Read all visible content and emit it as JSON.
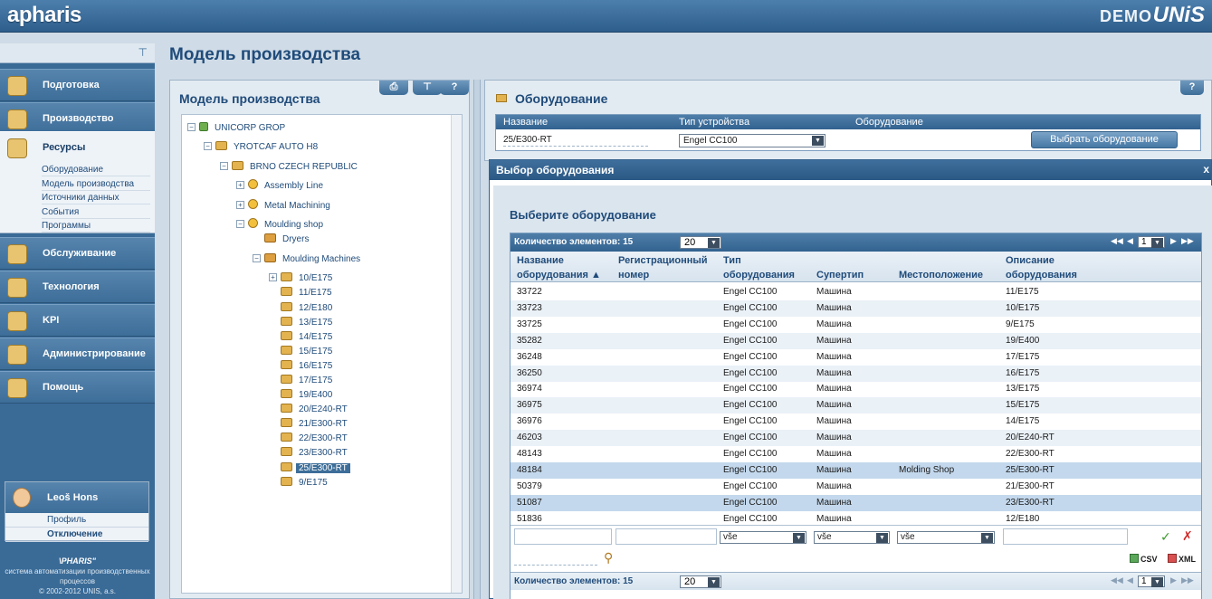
{
  "brand": {
    "logo": "apharis",
    "demo": "DEMO",
    "unis": "UNiS"
  },
  "page_title": "Модель производства",
  "menu": {
    "items": [
      {
        "label": "Подготовка",
        "icon": "book-icon"
      },
      {
        "label": "Производство",
        "icon": "wrench-icon"
      },
      {
        "label": "Ресурсы",
        "icon": "truck-icon"
      },
      {
        "label": "Обслуживание",
        "icon": "tools-icon"
      },
      {
        "label": "Технология",
        "icon": "gauge-icon"
      },
      {
        "label": "KPI",
        "icon": "chart-icon"
      },
      {
        "label": "Администрирование",
        "icon": "users-icon"
      },
      {
        "label": "Помощь",
        "icon": "help-icon"
      }
    ],
    "subitems": [
      "Оборудование",
      "Модель производства",
      "Источники данных",
      "События",
      "Программы"
    ]
  },
  "user": {
    "name": "Leoš Hons",
    "profile": "Профиль",
    "logout": "Отключение"
  },
  "footer": {
    "logo": "\\PHARIS\"",
    "line1": "система автоматизации производственных",
    "line2": "процессов",
    "copyright": "© 2002-2012 UNIS, a.s."
  },
  "tree_panel": {
    "title": "Модель производства",
    "buttons": {
      "print": "⎙",
      "pin": "⊤",
      "help": "?"
    },
    "nodes": [
      {
        "label": "UNICORP GROP",
        "level": 0,
        "exp": "−",
        "icon": "g"
      },
      {
        "label": "YROTCAF AUTO H8",
        "level": 1,
        "exp": "−",
        "icon": "f"
      },
      {
        "label": "BRNO CZECH REPUBLIC",
        "level": 2,
        "exp": "−",
        "icon": "f"
      },
      {
        "label": "Assembly Line",
        "level": 3,
        "exp": "+",
        "icon": "c"
      },
      {
        "label": "Metal Machining",
        "level": 3,
        "exp": "+",
        "icon": "c"
      },
      {
        "label": "Moulding shop",
        "level": 3,
        "exp": "−",
        "icon": "c"
      },
      {
        "label": "Dryers",
        "level": 4,
        "exp": "",
        "icon": "p"
      },
      {
        "label": "Moulding Machines",
        "level": 4,
        "exp": "−",
        "icon": "p"
      },
      {
        "label": "10/E175",
        "level": 5,
        "exp": "+",
        "icon": "f"
      },
      {
        "label": "11/E175",
        "level": 5,
        "exp": "",
        "icon": "f"
      },
      {
        "label": "12/E180",
        "level": 5,
        "exp": "",
        "icon": "f"
      },
      {
        "label": "13/E175",
        "level": 5,
        "exp": "",
        "icon": "f"
      },
      {
        "label": "14/E175",
        "level": 5,
        "exp": "",
        "icon": "f"
      },
      {
        "label": "15/E175",
        "level": 5,
        "exp": "",
        "icon": "f"
      },
      {
        "label": "16/E175",
        "level": 5,
        "exp": "",
        "icon": "f"
      },
      {
        "label": "17/E175",
        "level": 5,
        "exp": "",
        "icon": "f"
      },
      {
        "label": "19/E400",
        "level": 5,
        "exp": "",
        "icon": "f"
      },
      {
        "label": "20/E240-RT",
        "level": 5,
        "exp": "",
        "icon": "f"
      },
      {
        "label": "21/E300-RT",
        "level": 5,
        "exp": "",
        "icon": "f"
      },
      {
        "label": "22/E300-RT",
        "level": 5,
        "exp": "",
        "icon": "f"
      },
      {
        "label": "23/E300-RT",
        "level": 5,
        "exp": "",
        "icon": "f"
      },
      {
        "label": "25/E300-RT",
        "level": 5,
        "exp": "",
        "icon": "f",
        "selected": true
      },
      {
        "label": "9/E175",
        "level": 5,
        "exp": "",
        "icon": "f"
      }
    ]
  },
  "equipment_panel": {
    "title": "Оборудование",
    "help": "?",
    "headers": [
      "Название",
      "Тип устройства",
      "Оборудование"
    ],
    "name_value": "25/E300-RT",
    "type_value": "Engel CC100",
    "select_button": "Выбрать оборудование"
  },
  "modal": {
    "title": "Выбор оборудования",
    "close": "x",
    "subtitle": "Выберите оборудование",
    "count_label": "Количество элементов: 15",
    "page_size": "20",
    "page": "1",
    "columns": [
      {
        "line1": "Название",
        "line2": "оборудования ▲"
      },
      {
        "line1": "Регистрационный",
        "line2": "номер"
      },
      {
        "line1": "Тип",
        "line2": "оборудования"
      },
      {
        "line1": "",
        "line2": "Супертип"
      },
      {
        "line1": "",
        "line2": "Местоположение"
      },
      {
        "line1": "Описание",
        "line2": "оборудования"
      }
    ],
    "rows": [
      [
        "33722",
        "",
        "Engel CC100",
        "Машина",
        "",
        "11/E175"
      ],
      [
        "33723",
        "",
        "Engel CC100",
        "Машина",
        "",
        "10/E175"
      ],
      [
        "33725",
        "",
        "Engel CC100",
        "Машина",
        "",
        "9/E175"
      ],
      [
        "35282",
        "",
        "Engel CC100",
        "Машина",
        "",
        "19/E400"
      ],
      [
        "36248",
        "",
        "Engel CC100",
        "Машина",
        "",
        "17/E175"
      ],
      [
        "36250",
        "",
        "Engel CC100",
        "Машина",
        "",
        "16/E175"
      ],
      [
        "36974",
        "",
        "Engel CC100",
        "Машина",
        "",
        "13/E175"
      ],
      [
        "36975",
        "",
        "Engel CC100",
        "Машина",
        "",
        "15/E175"
      ],
      [
        "36976",
        "",
        "Engel CC100",
        "Машина",
        "",
        "14/E175"
      ],
      [
        "46203",
        "",
        "Engel CC100",
        "Машина",
        "",
        "20/E240-RT"
      ],
      [
        "48143",
        "",
        "Engel CC100",
        "Машина",
        "",
        "22/E300-RT"
      ],
      [
        "48184",
        "",
        "Engel CC100",
        "Машина",
        "Molding Shop",
        "25/E300-RT"
      ],
      [
        "50379",
        "",
        "Engel CC100",
        "Машина",
        "",
        "21/E300-RT"
      ],
      [
        "51087",
        "",
        "Engel CC100",
        "Машина",
        "",
        "23/E300-RT"
      ],
      [
        "51836",
        "",
        "Engel CC100",
        "Машина",
        "",
        "12/E180"
      ]
    ],
    "highlighted_row": 11,
    "selected_row": 13,
    "filter_all": "vše",
    "export_csv": "CSV",
    "export_xml": "XML"
  }
}
